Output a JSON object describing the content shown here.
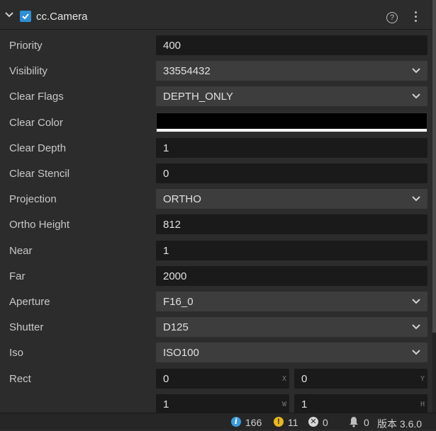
{
  "component": {
    "title": "cc.Camera",
    "enabled": true
  },
  "properties": [
    {
      "label": "Priority",
      "value": "400",
      "kind": "input"
    },
    {
      "label": "Visibility",
      "value": "33554432",
      "kind": "select"
    },
    {
      "label": "Clear Flags",
      "value": "DEPTH_ONLY",
      "kind": "select"
    },
    {
      "label": "Clear Color",
      "value": "#000000",
      "kind": "color"
    },
    {
      "label": "Clear Depth",
      "value": "1",
      "kind": "input"
    },
    {
      "label": "Clear Stencil",
      "value": "0",
      "kind": "input"
    },
    {
      "label": "Projection",
      "value": "ORTHO",
      "kind": "select"
    },
    {
      "label": "Ortho Height",
      "value": "812",
      "kind": "input"
    },
    {
      "label": "Near",
      "value": "1",
      "kind": "input"
    },
    {
      "label": "Far",
      "value": "2000",
      "kind": "input"
    },
    {
      "label": "Aperture",
      "value": "F16_0",
      "kind": "select"
    },
    {
      "label": "Shutter",
      "value": "D125",
      "kind": "select"
    },
    {
      "label": "Iso",
      "value": "ISO100",
      "kind": "select"
    }
  ],
  "rect": {
    "label": "Rect",
    "x": "0",
    "y": "0",
    "w": "1",
    "h": "1",
    "x_axis": "X",
    "y_axis": "Y",
    "w_axis": "W",
    "h_axis": "H"
  },
  "statusbar": {
    "info_count": "166",
    "warn_count": "11",
    "error_count": "0",
    "notify_count": "0",
    "version": "版本 3.6.0"
  },
  "colors": {
    "accent": "#2d8fd6",
    "info": "#3a9ce0",
    "warn": "#e8b81c",
    "clear_color": "#000000"
  }
}
